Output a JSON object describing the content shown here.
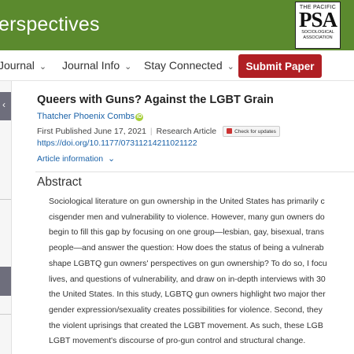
{
  "banner": {
    "journal_title": "erspectives",
    "logo": {
      "top": "THE PACIFIC",
      "big": "PSA",
      "bottom_1": "SOCIOLOGICAL",
      "bottom_2": "ASSOCIATION"
    }
  },
  "nav": {
    "item_1": "Journal",
    "item_2": "Journal Info",
    "item_3": "Stay Connected",
    "submit": "Submit Paper"
  },
  "article": {
    "title": "Queers with Guns? Against the LGBT Grain",
    "author": "Thatcher Phoenix Combs",
    "first_published": "First Published June 17, 2021",
    "article_type": "Research Article",
    "check_updates": "Check for updates",
    "doi": "https://doi.org/10.1177/07311214211021122",
    "article_info": "Article information"
  },
  "abstract": {
    "heading": "Abstract",
    "lines": [
      "Sociological literature on gun ownership in the United States has primarily c",
      "cisgender men and vulnerability to violence. However, many gun owners do",
      "begin to fill this gap by focusing on one group—lesbian, gay, bisexual, trans",
      "people—and answer the question: How does the status of being a vulnerab",
      "shape LGBTQ gun owners' perspectives on gun ownership? To do so, I focu",
      "lives, and questions of vulnerability, and draw on in-depth interviews with 30",
      "the United States. In this study, LGBTQ gun owners highlight two major ther",
      "gender expression/sexuality creates possibilities for violence. Second, they",
      "the violent uprisings that created the LGBT movement. As such, these LGB",
      "LGBT movement's discourse of pro-gun control and structural change."
    ]
  }
}
